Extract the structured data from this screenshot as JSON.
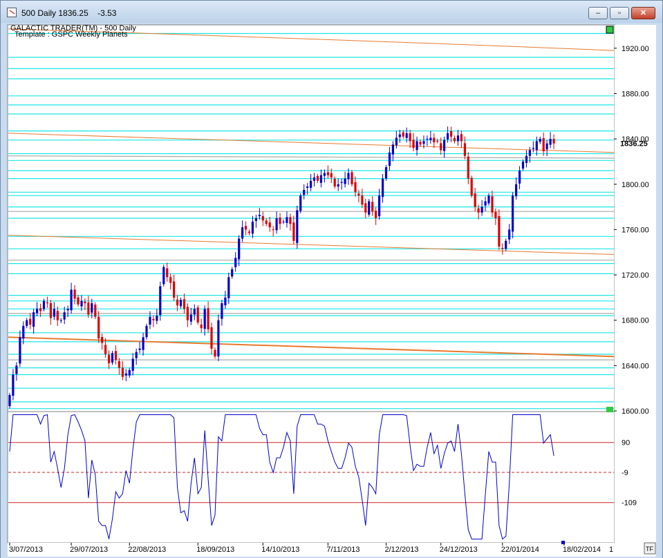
{
  "window": {
    "title": "500 Daily 1836.25    -3.53",
    "minimize_glyph": "‒",
    "maximize_glyph": "▫",
    "close_glyph": "✕"
  },
  "chart_data": {
    "type": "candlestick",
    "header": "GALACTIC TRADER(TM) - 500 Daily",
    "template": "Template : GSPC Weekly Planets",
    "last_price_label": "1836.25",
    "price_axis": {
      "min": 1600,
      "max": 1940,
      "ticks": [
        1600,
        1640,
        1680,
        1720,
        1760,
        1800,
        1840,
        1880,
        1920
      ],
      "tick_labels": [
        "1600.00",
        "1640.00",
        "1680.00",
        "1720.00",
        "1760.00",
        "1800.00",
        "1840.00",
        "1880.00",
        "1920.00"
      ]
    },
    "osc_axis": {
      "min": -240,
      "max": 190,
      "ticks": [
        90,
        -9,
        -109
      ],
      "tick_labels": [
        "90",
        "-9",
        "-109"
      ],
      "upper_line": 90,
      "lower_line": -109,
      "mid_line": -9
    },
    "date_labels": [
      "3/07/2013",
      "29/07/2013",
      "22/08/2013",
      "18/09/2013",
      "14/10/2013",
      "7/11/2013",
      "2/12/2013",
      "24/12/2013",
      "22/01/2014",
      "18/02/2014"
    ],
    "date_label_bars": [
      0,
      18,
      35,
      55,
      74,
      93,
      110,
      126,
      144,
      162
    ],
    "corner_label": "1",
    "tf_label": "TF",
    "colors": {
      "up": "#0000cc",
      "down": "#dd0000",
      "cyan_line": "#19e6e6",
      "orange_line": "#e8792e",
      "gray_line": "#a8a8a8",
      "osc_line": "#0000cc",
      "osc_ref": "#cc2222"
    },
    "cyan_levels": [
      1933,
      1912,
      1902,
      1893,
      1878,
      1870,
      1862,
      1847,
      1839,
      1827,
      1821,
      1812,
      1805,
      1793,
      1790,
      1780,
      1770,
      1754,
      1743,
      1730,
      1721,
      1702,
      1697,
      1690,
      1684,
      1669,
      1661,
      1650,
      1638,
      1632,
      1620,
      1608,
      1602
    ],
    "orange_lines": [
      {
        "start": 1937,
        "end": 1918,
        "width": 1
      },
      {
        "start": 1845,
        "end": 1828,
        "width": 1
      },
      {
        "start": 1755,
        "end": 1738,
        "width": 1
      },
      {
        "start": 1665,
        "end": 1648,
        "width": 2
      }
    ],
    "gray_lines": [
      {
        "start": 1825,
        "end": 1823
      },
      {
        "start": 1776,
        "end": 1776
      },
      {
        "start": 1733,
        "end": 1733
      },
      {
        "start": 1686,
        "end": 1686
      },
      {
        "start": 1645,
        "end": 1645
      }
    ],
    "closes": [
      1614,
      1632,
      1640,
      1665,
      1675,
      1680,
      1676,
      1687,
      1690,
      1688,
      1697,
      1695,
      1682,
      1690,
      1680,
      1680,
      1687,
      1690,
      1707,
      1699,
      1694,
      1697,
      1695,
      1685,
      1695,
      1683,
      1664,
      1660,
      1650,
      1642,
      1651,
      1645,
      1638,
      1630,
      1633,
      1636,
      1646,
      1652,
      1655,
      1665,
      1675,
      1683,
      1680,
      1684,
      1710,
      1727,
      1718,
      1713,
      1700,
      1693,
      1698,
      1690,
      1680,
      1685,
      1690,
      1678,
      1673,
      1690,
      1672,
      1655,
      1648,
      1680,
      1695,
      1700,
      1718,
      1725,
      1735,
      1752,
      1762,
      1760,
      1757,
      1767,
      1770,
      1773,
      1768,
      1765,
      1762,
      1760,
      1770,
      1765,
      1767,
      1771,
      1765,
      1750,
      1777,
      1790,
      1795,
      1798,
      1803,
      1806,
      1803,
      1808,
      1810,
      1808,
      1806,
      1798,
      1800,
      1802,
      1805,
      1810,
      1800,
      1793,
      1790,
      1782,
      1775,
      1785,
      1776,
      1770,
      1790,
      1805,
      1815,
      1828,
      1835,
      1841,
      1844,
      1842,
      1845,
      1838,
      1832,
      1838,
      1835,
      1838,
      1840,
      1841,
      1837,
      1838,
      1830,
      1839,
      1845,
      1842,
      1838,
      1843,
      1838,
      1825,
      1805,
      1790,
      1780,
      1775,
      1780,
      1785,
      1790,
      1775,
      1770,
      1745,
      1743,
      1750,
      1760,
      1790,
      1800,
      1812,
      1820,
      1825,
      1830,
      1832,
      1838,
      1840,
      1829,
      1836,
      1840,
      1836
    ]
  }
}
